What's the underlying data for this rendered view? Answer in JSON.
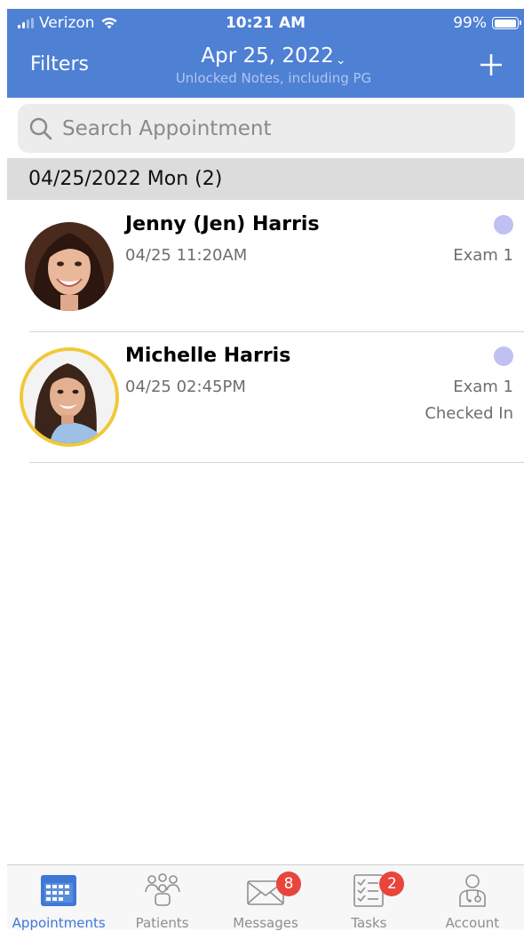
{
  "status_bar": {
    "carrier": "Verizon",
    "time": "10:21 AM",
    "battery": "99%",
    "battery_level": 0.99
  },
  "header": {
    "filters_label": "Filters",
    "date_title": "Apr 25, 2022",
    "date_chevron": "⌄",
    "subtitle": "Unlocked Notes, including PG",
    "add_icon": "plus-icon",
    "background_color": "#4e80d4"
  },
  "search": {
    "placeholder": "Search Appointment",
    "value": ""
  },
  "section": {
    "title": "04/25/2022 Mon (2)"
  },
  "appointments": [
    {
      "name": "Jenny (Jen) Harris",
      "time": "04/25 11:20AM",
      "room": "Exam 1",
      "status": "",
      "status_dot_color": "#c0c0f2",
      "avatar_ring": false
    },
    {
      "name": "Michelle Harris",
      "time": "04/25 02:45PM",
      "room": "Exam 1",
      "status": "Checked In",
      "status_dot_color": "#c0c0f2",
      "avatar_ring": true,
      "avatar_ring_color": "#f0c93a"
    }
  ],
  "tab_bar": {
    "tabs": [
      {
        "label": "Appointments",
        "icon": "calendar-icon",
        "active": true,
        "badge": ""
      },
      {
        "label": "Patients",
        "icon": "patients-icon",
        "active": false,
        "badge": ""
      },
      {
        "label": "Messages",
        "icon": "envelope-icon",
        "active": false,
        "badge": "8"
      },
      {
        "label": "Tasks",
        "icon": "checklist-icon",
        "active": false,
        "badge": "2"
      },
      {
        "label": "Account",
        "icon": "doctor-icon",
        "active": false,
        "badge": ""
      }
    ],
    "active_color": "#3d78d6"
  }
}
